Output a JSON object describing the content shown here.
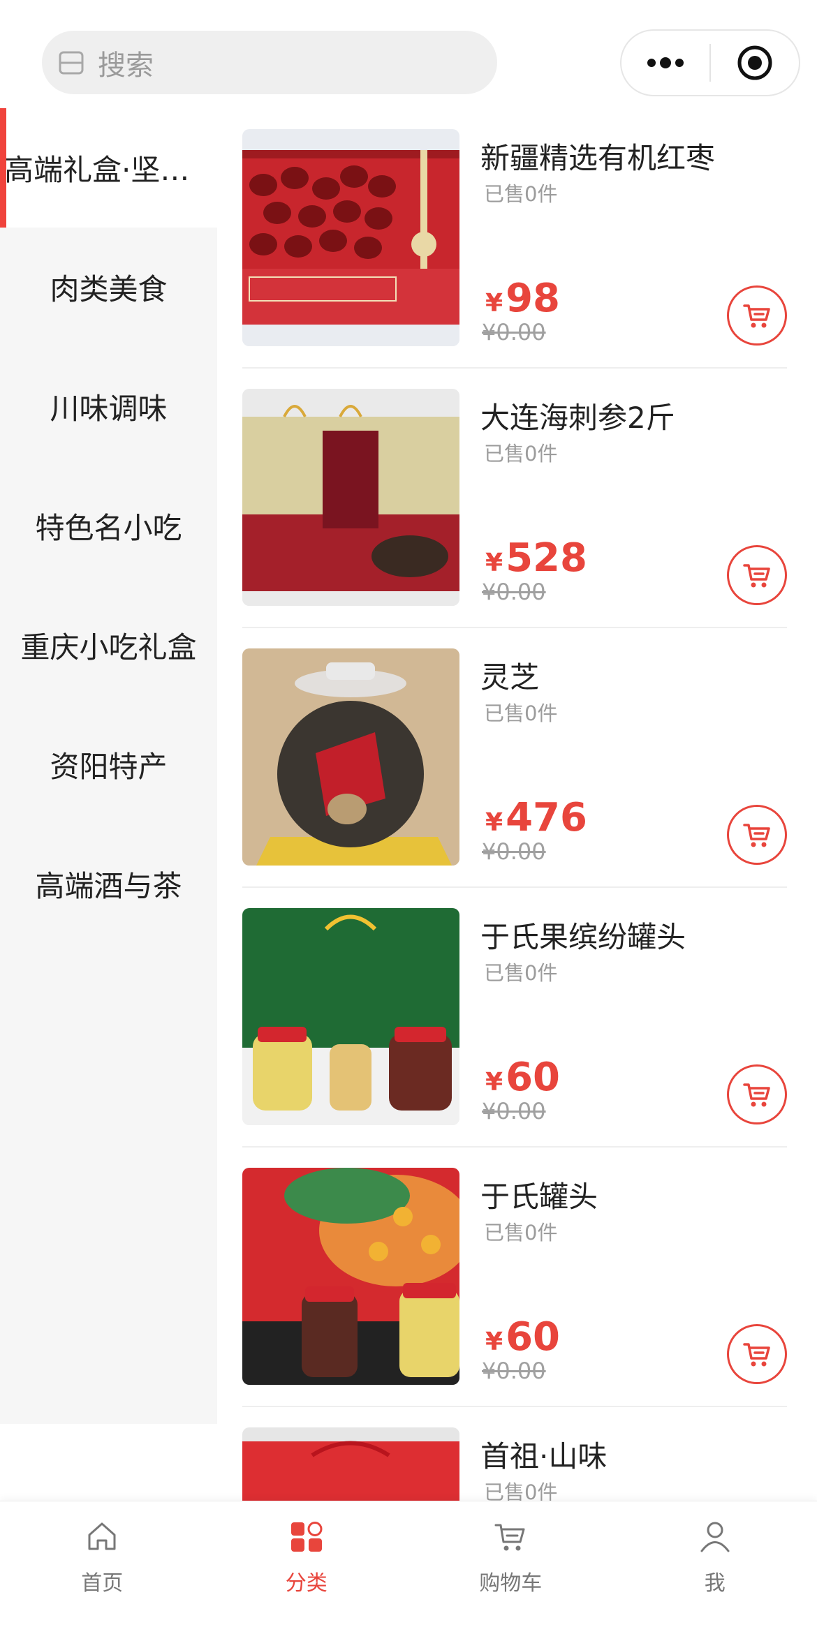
{
  "search": {
    "placeholder": "搜索"
  },
  "sidebar": {
    "items": [
      {
        "label": "高端礼盒·坚果干货",
        "active": true
      },
      {
        "label": "肉类美食"
      },
      {
        "label": "川味调味"
      },
      {
        "label": "特色名小吃"
      },
      {
        "label": "重庆小吃礼盒"
      },
      {
        "label": "资阳特产"
      },
      {
        "label": "高端酒与茶"
      }
    ]
  },
  "products": [
    {
      "name": "新疆精选有机红枣",
      "sold": "已售0件",
      "currency": "¥",
      "price": "98",
      "original": "¥0.00",
      "image": "red-dates-giftbox-image"
    },
    {
      "name": "大连海刺参2斤",
      "sold": "已售0件",
      "currency": "¥",
      "price": "528",
      "original": "¥0.00",
      "image": "sea-cucumber-giftbox-image"
    },
    {
      "name": "灵芝",
      "sold": "已售0件",
      "currency": "¥",
      "price": "476",
      "original": "¥0.00",
      "image": "lingzhi-jar-image"
    },
    {
      "name": "于氏果缤纷罐头",
      "sold": "已售0件",
      "currency": "¥",
      "price": "60",
      "original": "¥0.00",
      "image": "yushi-fruit-can-giftbox-image"
    },
    {
      "name": "于氏罐头",
      "sold": "已售0件",
      "currency": "¥",
      "price": "60",
      "original": "¥0.00",
      "image": "yushi-can-giftbox-image"
    },
    {
      "name": "首祖·山味",
      "sold": "已售0件",
      "currency": "¥",
      "price": "",
      "original": "",
      "image": "shanwei-giftbox-image"
    }
  ],
  "tabbar": {
    "items": [
      {
        "label": "首页",
        "icon": "home-icon"
      },
      {
        "label": "分类",
        "icon": "category-icon",
        "active": true
      },
      {
        "label": "购物车",
        "icon": "cart-icon"
      },
      {
        "label": "我",
        "icon": "user-icon"
      }
    ]
  },
  "colors": {
    "accent": "#e8453c",
    "sidebar_bg": "#f6f6f6"
  }
}
